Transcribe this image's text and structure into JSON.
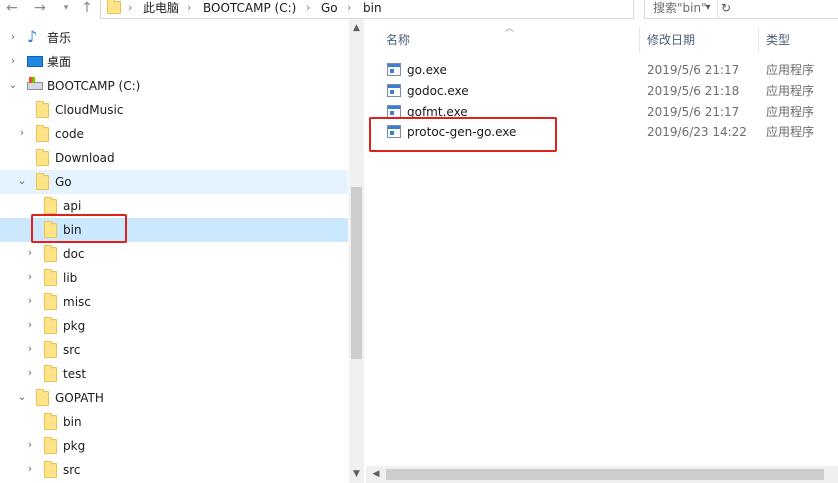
{
  "address_bar": {
    "back_icon": "back-arrow-icon",
    "forward_icon": "forward-arrow-icon",
    "up_icon": "up-arrow-icon",
    "breadcrumbs": [
      "此电脑",
      "BOOTCAMP (C:)",
      "Go",
      "bin"
    ],
    "search_placeholder": "搜索\"bin\""
  },
  "nav_tree": [
    {
      "label": "音乐",
      "icon": "music-icon",
      "expanded": false
    },
    {
      "label": "桌面",
      "icon": "desktop-icon",
      "expanded": false
    },
    {
      "label": "BOOTCAMP (C:)",
      "icon": "drive-icon",
      "expanded": true
    },
    {
      "label": "CloudMusic",
      "icon": "folder-icon"
    },
    {
      "label": "code",
      "icon": "folder-icon"
    },
    {
      "label": "Download",
      "icon": "folder-icon"
    },
    {
      "label": "Go",
      "icon": "folder-icon",
      "expanded": true
    },
    {
      "label": "api",
      "icon": "folder-icon"
    },
    {
      "label": "bin",
      "icon": "folder-icon",
      "selected": true
    },
    {
      "label": "doc",
      "icon": "folder-icon"
    },
    {
      "label": "lib",
      "icon": "folder-icon"
    },
    {
      "label": "misc",
      "icon": "folder-icon"
    },
    {
      "label": "pkg",
      "icon": "folder-icon"
    },
    {
      "label": "src",
      "icon": "folder-icon"
    },
    {
      "label": "test",
      "icon": "folder-icon"
    },
    {
      "label": "GOPATH",
      "icon": "folder-icon",
      "expanded": true
    },
    {
      "label": "bin",
      "icon": "folder-icon"
    },
    {
      "label": "pkg",
      "icon": "folder-icon"
    },
    {
      "label": "src",
      "icon": "folder-icon"
    }
  ],
  "columns": {
    "name": "名称",
    "modified": "修改日期",
    "type": "类型"
  },
  "files": [
    {
      "name": "go.exe",
      "modified": "2019/5/6 21:17",
      "type": "应用程序"
    },
    {
      "name": "godoc.exe",
      "modified": "2019/5/6 21:18",
      "type": "应用程序"
    },
    {
      "name": "gofmt.exe",
      "modified": "2019/5/6 21:17",
      "type": "应用程序"
    },
    {
      "name": "protoc-gen-go.exe",
      "modified": "2019/6/23 14:22",
      "type": "应用程序"
    }
  ],
  "colors": {
    "selection": "#cce8ff",
    "highlight_box": "#e0201b"
  }
}
